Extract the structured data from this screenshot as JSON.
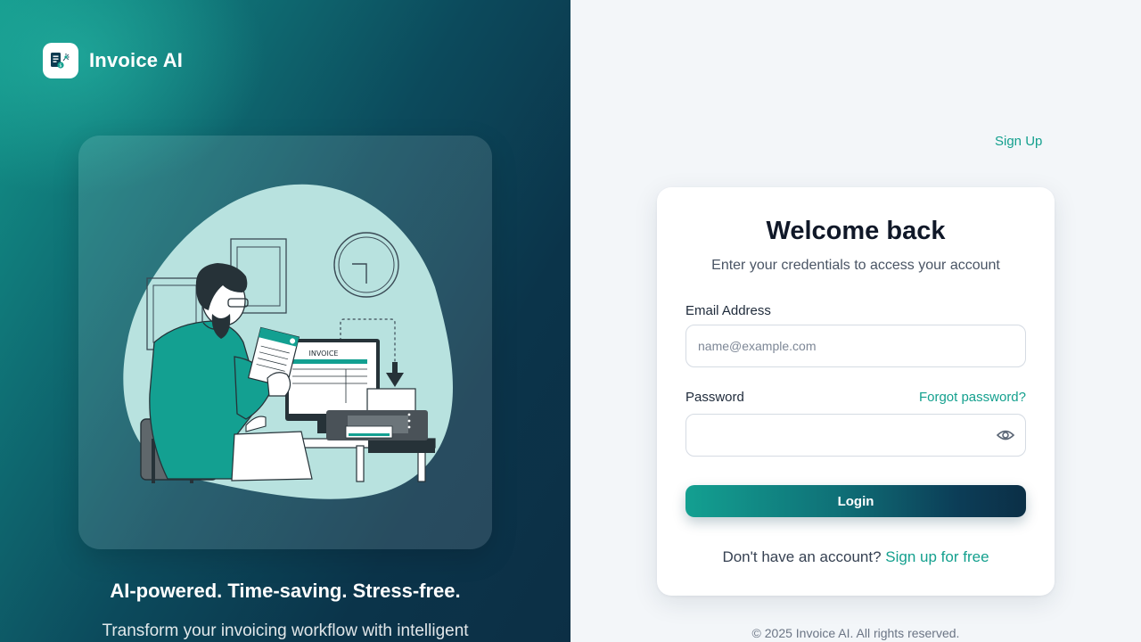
{
  "brand": {
    "name": "Invoice AI",
    "logo_icon": "invoice-ai-logo-icon"
  },
  "illustration": {
    "invoice_label": "INVOICE"
  },
  "hero": {
    "tagline": "AI-powered. Time-saving. Stress-free.",
    "subtext": "Transform your invoicing workflow with intelligent"
  },
  "nav": {
    "signup_label": "Sign Up"
  },
  "login": {
    "title": "Welcome back",
    "subtitle": "Enter your credentials to access your account",
    "email_label": "Email Address",
    "email_placeholder": "name@example.com",
    "email_value": "",
    "password_label": "Password",
    "password_value": "",
    "forgot_label": "Forgot password?",
    "button_label": "Login",
    "no_account_text": "Don't have an account?",
    "signup_free_label": "Sign up for free"
  },
  "footer": {
    "copyright": "© 2025 Invoice AI. All rights reserved."
  },
  "colors": {
    "accent": "#14a08e",
    "dark_navy": "#0b2f46",
    "title_text": "#101828",
    "blob": "#b8e2df",
    "shirt": "#13a091"
  }
}
